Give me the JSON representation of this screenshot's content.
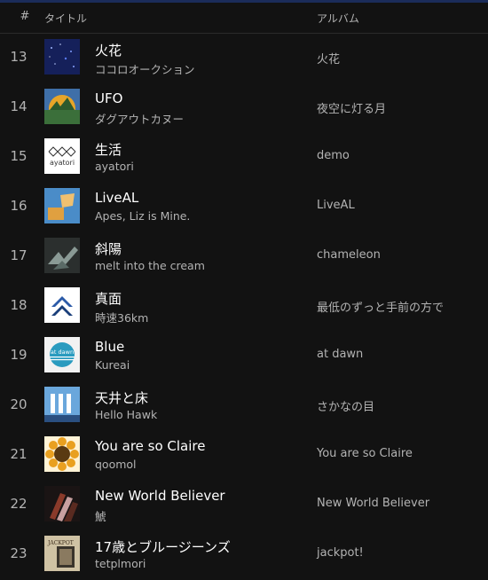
{
  "header": {
    "num_label": "#",
    "title_label": "タイトル",
    "album_label": "アルバム"
  },
  "tracks": [
    {
      "num": "13",
      "title": "火花",
      "artist": "ココロオークション",
      "album": "火花",
      "art": "hibana-album-art"
    },
    {
      "num": "14",
      "title": "UFO",
      "artist": "ダグアウトカヌー",
      "album": "夜空に灯る月",
      "art": "ufo-album-art"
    },
    {
      "num": "15",
      "title": "生活",
      "artist": "ayatori",
      "album": "demo",
      "art": "ayatori-logo-art",
      "art_text": "ayatori"
    },
    {
      "num": "16",
      "title": "LiveAL",
      "artist": "Apes, Liz is Mine.",
      "album": "LiveAL",
      "art": "liveal-album-art"
    },
    {
      "num": "17",
      "title": "斜陽",
      "artist": "melt into the cream",
      "album": "chameleon",
      "art": "chameleon-album-art"
    },
    {
      "num": "18",
      "title": "真面",
      "artist": "時速36km",
      "album": "最低のずっと手前の方で",
      "art": "chevron-album-art"
    },
    {
      "num": "19",
      "title": "Blue",
      "artist": "Kureai",
      "album": "at dawn",
      "art": "at-dawn-album-art",
      "art_text": "at dawn"
    },
    {
      "num": "20",
      "title": "天井と床",
      "artist": "Hello Hawk",
      "album": "さかなの目",
      "art": "sakana-album-art"
    },
    {
      "num": "21",
      "title": "You are so Claire",
      "artist": "qoomol",
      "album": "You are so Claire",
      "art": "sunflower-album-art"
    },
    {
      "num": "22",
      "title": "New World Believer",
      "artist": "鯱",
      "album": "New World Believer",
      "art": "new-world-album-art"
    },
    {
      "num": "23",
      "title": "17歳とブルージーンズ",
      "artist": "tetplmori",
      "album": "jackpot!",
      "art": "jackpot-album-art",
      "art_text": "JACKPOT"
    }
  ],
  "colors": {
    "background": "#121212",
    "primary_text": "#ffffff",
    "secondary_text": "#b3b3b3",
    "top_accent": "#1b2c5a"
  }
}
